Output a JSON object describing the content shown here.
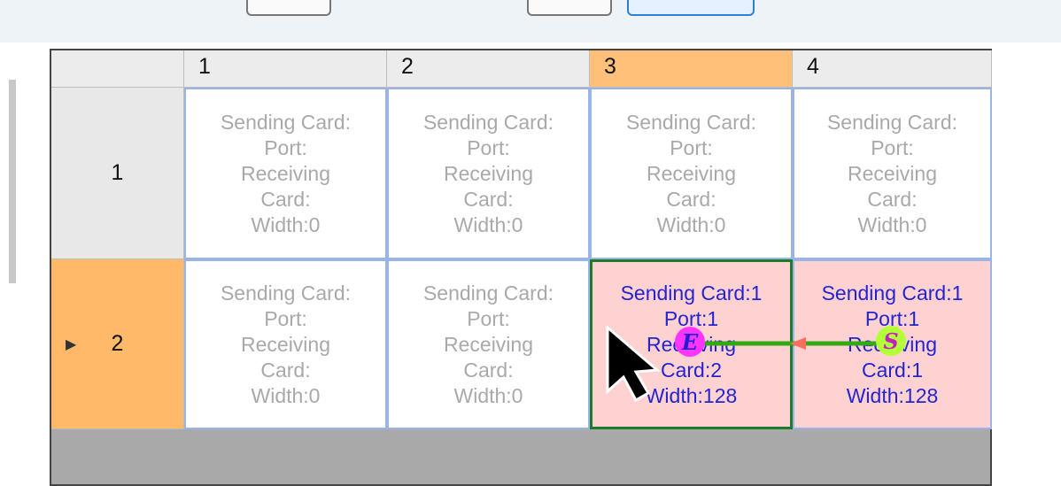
{
  "columns": [
    {
      "label": "1",
      "selected": false
    },
    {
      "label": "2",
      "selected": false
    },
    {
      "label": "3",
      "selected": true
    },
    {
      "label": "4",
      "selected": false
    }
  ],
  "rows": [
    {
      "label": "1",
      "selected": false,
      "cells": [
        [
          "Sending Card:",
          "Port:",
          "Receiving",
          "Card:",
          "Width:0"
        ],
        [
          "Sending Card:",
          "Port:",
          "Receiving",
          "Card:",
          "Width:0"
        ],
        [
          "Sending Card:",
          "Port:",
          "Receiving",
          "Card:",
          "Width:0"
        ],
        [
          "Sending Card:",
          "Port:",
          "Receiving",
          "Card:",
          "Width:0"
        ]
      ]
    },
    {
      "label": "2",
      "selected": true,
      "cells": [
        [
          "Sending Card:",
          "Port:",
          "Receiving",
          "Card:",
          "Width:0"
        ],
        [
          "Sending Card:",
          "Port:",
          "Receiving",
          "Card:",
          "Width:0"
        ],
        [
          "Sending Card:1",
          "Port:1",
          "Receiving",
          "Card:2",
          "Width:128"
        ],
        [
          "Sending Card:1",
          "Port:1",
          "Receiving",
          "Card:1",
          "Width:128"
        ]
      ]
    }
  ],
  "markers": {
    "end": "E",
    "start": "S"
  },
  "colors": {
    "selected_header": "#ffc07a",
    "assigned_cell": "#ffd2d2",
    "assigned_text": "#2424d0",
    "current_border": "#1d7a2a",
    "connection_line": "#33aa11",
    "arrow_head": "#ff6b5c"
  }
}
